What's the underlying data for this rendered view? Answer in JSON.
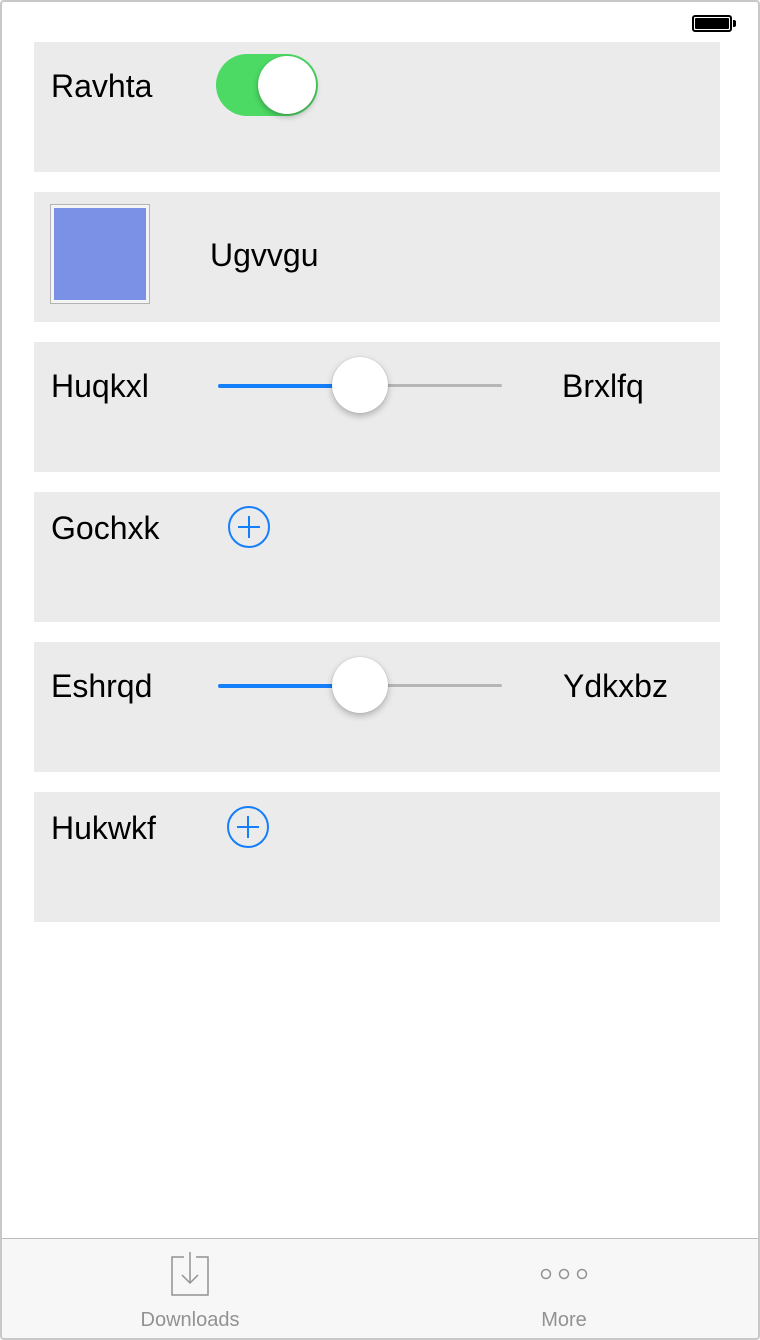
{
  "status_bar": {
    "battery_icon": "battery-full-icon"
  },
  "rows": [
    {
      "type": "toggle",
      "label": "Ravhta",
      "on": true,
      "color_on": "#4cd964"
    },
    {
      "type": "color",
      "label": "Ugvvgu",
      "swatch_color": "#7b91e6"
    },
    {
      "type": "slider",
      "label": "Huqkxl",
      "end_label": "Brxlfq",
      "value": 0.5
    },
    {
      "type": "add",
      "label": "Gochxk",
      "icon": "plus-circle-icon"
    },
    {
      "type": "slider",
      "label": "Eshrqd",
      "end_label": "Ydkxbz",
      "value": 0.5
    },
    {
      "type": "add",
      "label": "Hukwkf",
      "icon": "plus-circle-icon"
    }
  ],
  "tab_bar": {
    "tabs": [
      {
        "label": "Downloads",
        "icon": "downloads-icon"
      },
      {
        "label": "More",
        "icon": "more-icon"
      }
    ]
  },
  "colors": {
    "accent": "#157efb",
    "card_bg": "#ebebeb",
    "tab_label": "#929292"
  }
}
